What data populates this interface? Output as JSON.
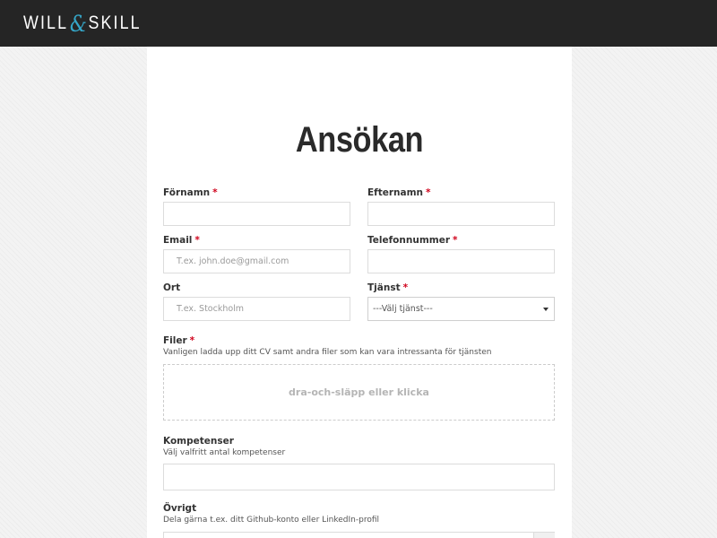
{
  "header": {
    "logo_left": "WILL",
    "logo_amp": "&",
    "logo_right": "SKILL",
    "accent_color": "#35a6c8"
  },
  "form": {
    "title": "Ansökan",
    "required_mark": "*",
    "fields": {
      "fornamn": {
        "label": "Förnamn",
        "value": "",
        "placeholder": ""
      },
      "efternamn": {
        "label": "Efternamn",
        "value": "",
        "placeholder": ""
      },
      "email": {
        "label": "Email",
        "value": "",
        "placeholder": "T.ex. john.doe@gmail.com"
      },
      "telefon": {
        "label": "Telefonnummer",
        "value": "",
        "placeholder": ""
      },
      "ort": {
        "label": "Ort",
        "value": "",
        "placeholder": "T.ex. Stockholm"
      },
      "tjanst": {
        "label": "Tjänst",
        "selected": "---Välj tjänst---"
      },
      "filer": {
        "label": "Filer",
        "help": "Vanligen ladda upp ditt CV samt andra filer som kan vara intressanta för tjänsten",
        "dropzone_text": "dra-och-släpp eller klicka"
      },
      "kompetenser": {
        "label": "Kompetenser",
        "help": "Välj valfritt antal kompetenser",
        "value": ""
      },
      "ovrigt": {
        "label": "Övrigt",
        "help": "Dela gärna t.ex. ditt Github-konto eller LinkedIn-profil",
        "value": ""
      }
    }
  }
}
